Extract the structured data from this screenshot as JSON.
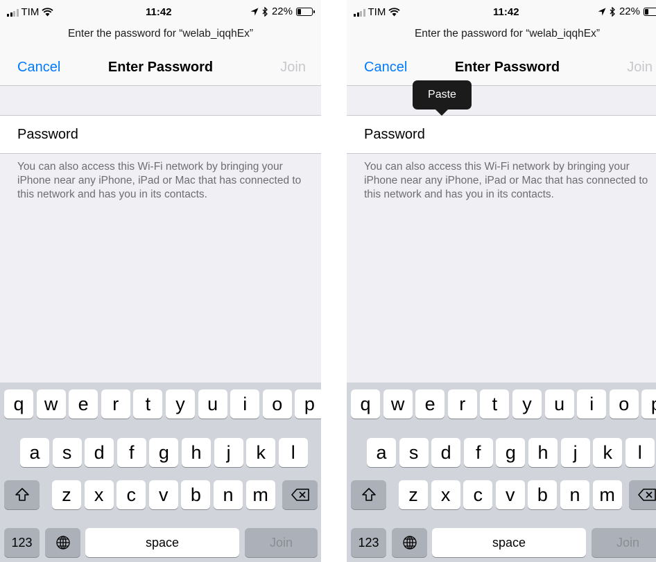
{
  "status": {
    "carrier": "TIM",
    "time": "11:42",
    "battery": "22%",
    "battery_level": 0.22
  },
  "prompt": "Enter the password for “welab_iqqhEx”",
  "nav": {
    "cancel": "Cancel",
    "title": "Enter Password",
    "join": "Join"
  },
  "password_field": {
    "placeholder": "Password",
    "value": ""
  },
  "footer_note": "You can also access this Wi-Fi network by bringing your iPhone near any iPhone, iPad or Mac that has connected to this network and has you in its contacts.",
  "popover": {
    "paste": "Paste"
  },
  "keyboard": {
    "row1": [
      "q",
      "w",
      "e",
      "r",
      "t",
      "y",
      "u",
      "i",
      "o",
      "p"
    ],
    "row2": [
      "a",
      "s",
      "d",
      "f",
      "g",
      "h",
      "j",
      "k",
      "l"
    ],
    "row3": [
      "z",
      "x",
      "c",
      "v",
      "b",
      "n",
      "m"
    ],
    "numbers": "123",
    "space": "space",
    "return": "Join"
  },
  "colors": {
    "accent": "#007aff",
    "disabled": "#c7c7cc",
    "background": "#efeff4",
    "keyboard_bg": "#d1d4da"
  }
}
